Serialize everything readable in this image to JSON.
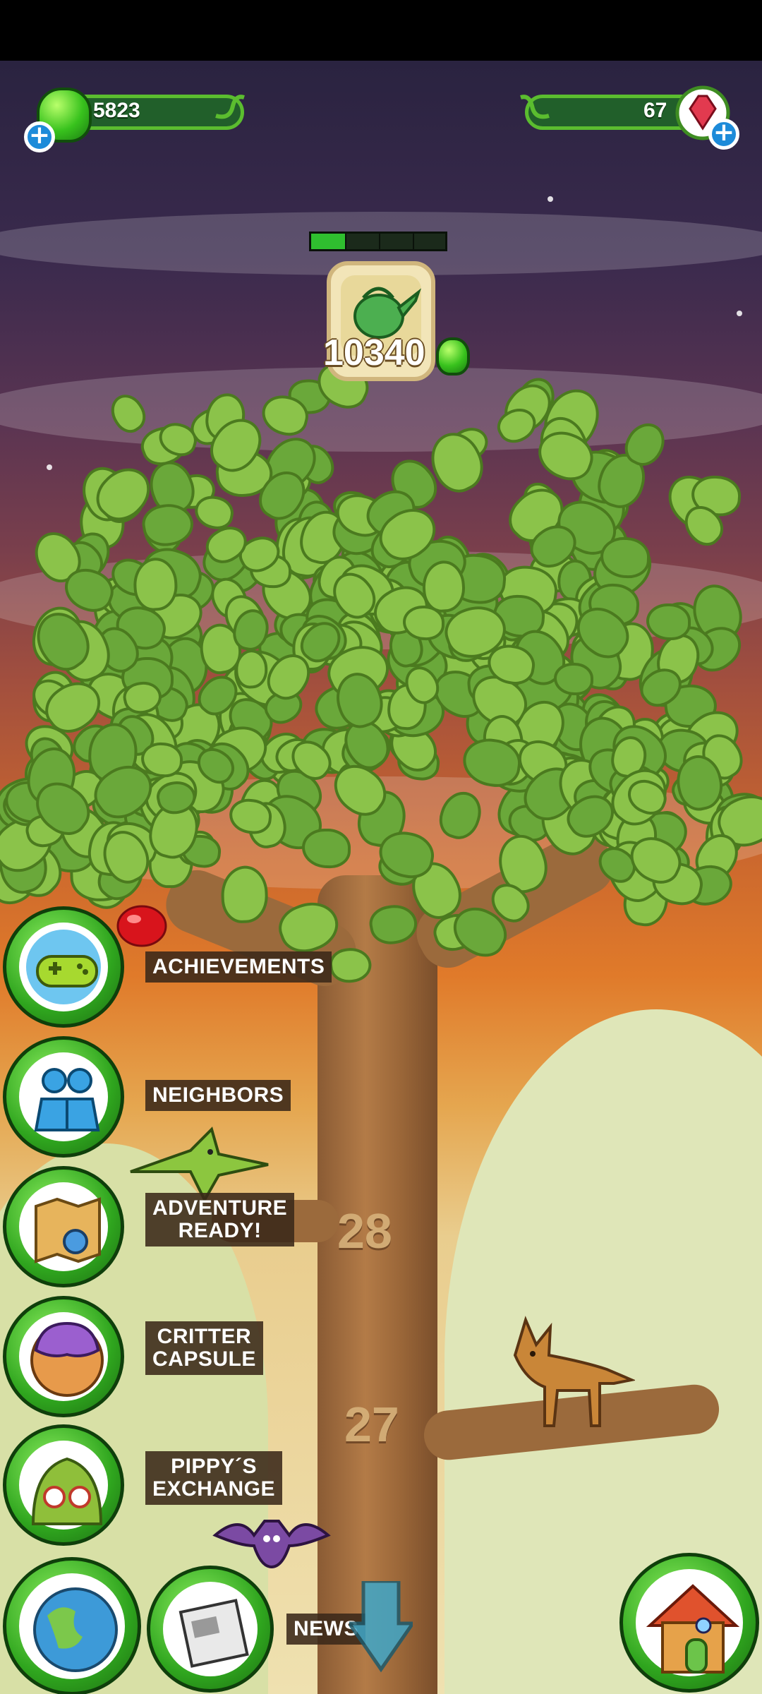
{
  "currency": {
    "green_amount": "5823",
    "red_amount": "67",
    "add_green_symbol": "+",
    "add_red_symbol": "+"
  },
  "tree": {
    "water_cost": "10340",
    "level_upper": "28",
    "level_lower": "27",
    "growth_progress": 0.25
  },
  "menu": {
    "achievements": "ACHIEVEMENTS",
    "neighbors": "NEIGHBORS",
    "adventure": "ADVENTURE\nREADY!",
    "critter_capsule": "CRITTER\nCAPSULE",
    "pippys_exchange": "PIPPY´S\nEXCHANGE",
    "news": "NEWS"
  },
  "icons": {
    "achievements": "gamepad-icon",
    "neighbors": "people-icon",
    "adventure": "map-icon",
    "critter_capsule": "capsule-icon",
    "pippys_exchange": "pippy-face-icon",
    "world": "globe-icon",
    "news": "newspaper-icon",
    "home": "house-icon",
    "water": "watering-can-icon"
  },
  "colors": {
    "accent_green": "#5bbd2f",
    "label_bg": "#3a2819"
  }
}
